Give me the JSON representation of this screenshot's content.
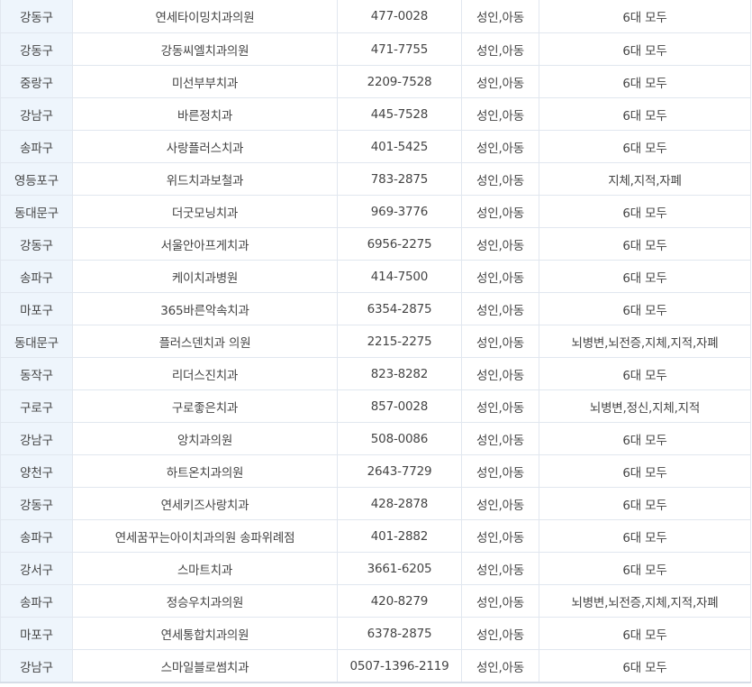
{
  "rows": [
    {
      "district": "강동구",
      "name": "연세타이밍치과의원",
      "phone": "477-0028",
      "target": "성인,아동",
      "coverage": "6대 모두"
    },
    {
      "district": "강동구",
      "name": "강동씨엘치과의원",
      "phone": "471-7755",
      "target": "성인,아동",
      "coverage": "6대 모두"
    },
    {
      "district": "중랑구",
      "name": "미선부부치과",
      "phone": "2209-7528",
      "target": "성인,아동",
      "coverage": "6대 모두"
    },
    {
      "district": "강남구",
      "name": "바른정치과",
      "phone": "445-7528",
      "target": "성인,아동",
      "coverage": "6대 모두"
    },
    {
      "district": "송파구",
      "name": "사랑플러스치과",
      "phone": "401-5425",
      "target": "성인,아동",
      "coverage": "6대 모두"
    },
    {
      "district": "영등포구",
      "name": "위드치과보철과",
      "phone": "783-2875",
      "target": "성인,아동",
      "coverage": "지체,지적,자폐"
    },
    {
      "district": "동대문구",
      "name": "더굿모닝치과",
      "phone": "969-3776",
      "target": "성인,아동",
      "coverage": "6대 모두"
    },
    {
      "district": "강동구",
      "name": "서울안아프게치과",
      "phone": "6956-2275",
      "target": "성인,아동",
      "coverage": "6대 모두"
    },
    {
      "district": "송파구",
      "name": "케이치과병원",
      "phone": "414-7500",
      "target": "성인,아동",
      "coverage": "6대 모두"
    },
    {
      "district": "마포구",
      "name": "365바른악속치과",
      "phone": "6354-2875",
      "target": "성인,아동",
      "coverage": "6대 모두"
    },
    {
      "district": "동대문구",
      "name": "플러스덴치과 의원",
      "phone": "2215-2275",
      "target": "성인,아동",
      "coverage": "뇌병변,뇌전증,지체,지적,자폐"
    },
    {
      "district": "동작구",
      "name": "리더스진치과",
      "phone": "823-8282",
      "target": "성인,아동",
      "coverage": "6대 모두"
    },
    {
      "district": "구로구",
      "name": "구로좋은치과",
      "phone": "857-0028",
      "target": "성인,아동",
      "coverage": "뇌병변,정신,지체,지적"
    },
    {
      "district": "강남구",
      "name": "앙치과의원",
      "phone": "508-0086",
      "target": "성인,아동",
      "coverage": "6대 모두"
    },
    {
      "district": "양천구",
      "name": "하트온치과의원",
      "phone": "2643-7729",
      "target": "성인,아동",
      "coverage": "6대 모두"
    },
    {
      "district": "강동구",
      "name": "연세키즈사랑치과",
      "phone": "428-2878",
      "target": "성인,아동",
      "coverage": "6대 모두"
    },
    {
      "district": "송파구",
      "name": "연세꿈꾸는아이치과의원 송파위례점",
      "phone": "401-2882",
      "target": "성인,아동",
      "coverage": "6대 모두"
    },
    {
      "district": "강서구",
      "name": "스마트치과",
      "phone": "3661-6205",
      "target": "성인,아동",
      "coverage": "6대 모두"
    },
    {
      "district": "송파구",
      "name": "정승우치과의원",
      "phone": "420-8279",
      "target": "성인,아동",
      "coverage": "뇌병변,뇌전증,지체,지적,자폐"
    },
    {
      "district": "마포구",
      "name": "연세통합치과의원",
      "phone": "6378-2875",
      "target": "성인,아동",
      "coverage": "6대 모두"
    },
    {
      "district": "강남구",
      "name": "스마일블로썸치과",
      "phone": "0507-1396-2119",
      "target": "성인,아동",
      "coverage": "6대 모두"
    }
  ],
  "colors": {
    "district_cell_bg": "#eef5fc",
    "grid_line": "#e1e7ef",
    "text": "#444444"
  }
}
